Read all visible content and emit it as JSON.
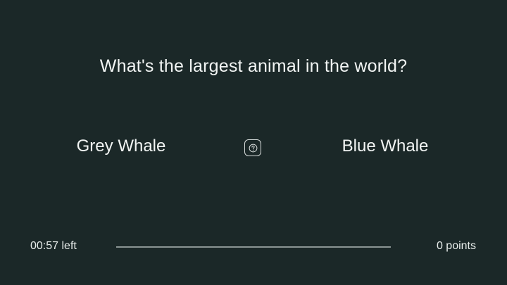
{
  "quiz": {
    "question": "What's the largest animal in the world?",
    "answers": [
      {
        "label": "Grey Whale"
      },
      {
        "label": "Blue Whale"
      }
    ],
    "help_icon": "question-mark-icon"
  },
  "status": {
    "time_value": "00:57",
    "time_suffix": "left",
    "points_value": "0",
    "points_suffix": "points",
    "progress_fraction": 1.0
  },
  "colors": {
    "background": "#1b2828",
    "text": "#f1f4f3",
    "progress_track": "#4c5857"
  }
}
